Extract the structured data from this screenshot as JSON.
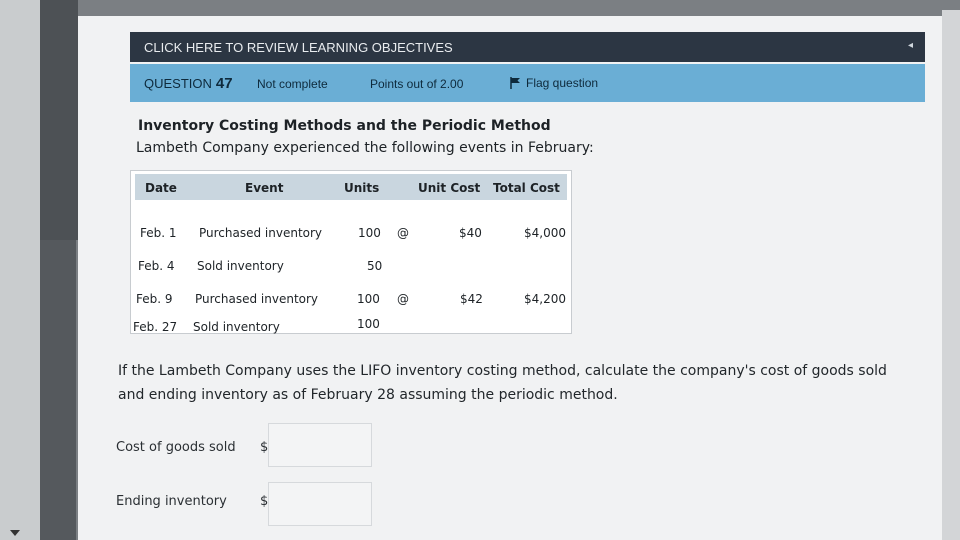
{
  "header": {
    "objectives_link": "CLICK HERE TO REVIEW LEARNING OBJECTIVES",
    "collapse_glyph": "◂"
  },
  "question_bar": {
    "question_label": "QUESTION",
    "question_number": "47",
    "status": "Not complete",
    "points": "Points out of 2.00",
    "flag_label": "Flag question"
  },
  "content": {
    "title": "Inventory Costing Methods and the Periodic Method",
    "intro": "Lambeth Company experienced the following events in February:",
    "table": {
      "headers": [
        "Date",
        "Event",
        "Units",
        "Unit Cost",
        "Total Cost"
      ],
      "rows": [
        {
          "date": "Feb. 1",
          "event": "Purchased inventory",
          "units": "100",
          "at": "@",
          "unit_cost": "$40",
          "total_cost": "$4,000"
        },
        {
          "date": "Feb. 4",
          "event": "Sold inventory",
          "units": "50",
          "at": "",
          "unit_cost": "",
          "total_cost": ""
        },
        {
          "date": "Feb. 9",
          "event": "Purchased inventory",
          "units": "100",
          "at": "@",
          "unit_cost": "$42",
          "total_cost": "$4,200"
        },
        {
          "date": "Feb. 27",
          "event": "Sold inventory",
          "units": "100",
          "at": "",
          "unit_cost": "",
          "total_cost": ""
        }
      ]
    },
    "question_text": "If the Lambeth Company uses the LIFO inventory costing method, calculate the company's cost of goods sold and ending inventory as of February 28 assuming the periodic method."
  },
  "answers": {
    "cogs_label": "Cost of goods sold",
    "cogs_currency": "$",
    "cogs_value": "",
    "ending_label": "Ending inventory",
    "ending_currency": "$",
    "ending_value": ""
  },
  "colors": {
    "topbar": "#2c3643",
    "question_bar": "#6aaed5",
    "table_header": "#c9d6df"
  }
}
